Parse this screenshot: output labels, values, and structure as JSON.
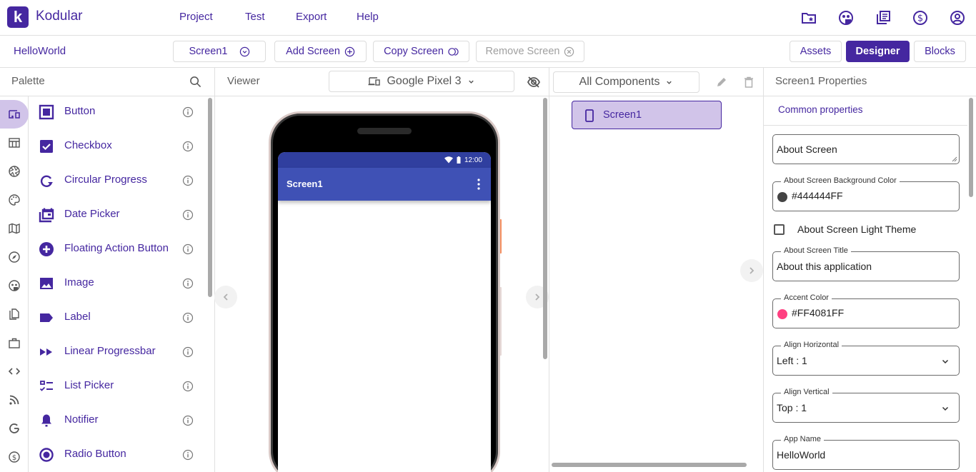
{
  "app": {
    "logo_letter": "k",
    "brand": "Kodular"
  },
  "topmenu": [
    {
      "label": "Project"
    },
    {
      "label": "Test"
    },
    {
      "label": "Export"
    },
    {
      "label": "Help"
    }
  ],
  "topicons": [
    "folder-star-icon",
    "community-icon",
    "library-icon",
    "dollar-icon",
    "account-icon"
  ],
  "toolbar": {
    "project_name": "HelloWorld",
    "screen_select": "Screen1",
    "add_screen": "Add Screen",
    "copy_screen": "Copy Screen",
    "remove_screen": "Remove Screen",
    "assets": "Assets",
    "designer": "Designer",
    "blocks": "Blocks"
  },
  "palette": {
    "title": "Palette",
    "categories": [
      "user-interface",
      "layout",
      "media",
      "drawing",
      "maps",
      "sensors",
      "social",
      "storage",
      "utilities",
      "connectivity",
      "dynamic",
      "google",
      "monetization"
    ],
    "items": [
      {
        "label": "Button",
        "icon": "button-icon"
      },
      {
        "label": "Checkbox",
        "icon": "checkbox-icon"
      },
      {
        "label": "Circular Progress",
        "icon": "circular-progress-icon"
      },
      {
        "label": "Date Picker",
        "icon": "date-picker-icon"
      },
      {
        "label": "Floating Action Button",
        "icon": "fab-icon"
      },
      {
        "label": "Image",
        "icon": "image-icon"
      },
      {
        "label": "Label",
        "icon": "label-icon"
      },
      {
        "label": "Linear Progressbar",
        "icon": "linear-progressbar-icon"
      },
      {
        "label": "List Picker",
        "icon": "list-picker-icon"
      },
      {
        "label": "Notifier",
        "icon": "notifier-icon"
      },
      {
        "label": "Radio Button",
        "icon": "radio-button-icon"
      }
    ]
  },
  "viewer": {
    "title": "Viewer",
    "device": "Google Pixel 3",
    "phone": {
      "time": "12:00",
      "screen_title": "Screen1"
    }
  },
  "components": {
    "filter": "All Components",
    "tree": [
      {
        "label": "Screen1",
        "selected": true
      }
    ]
  },
  "properties": {
    "title": "Screen1 Properties",
    "section": "Common properties",
    "about_screen": {
      "placeholder": "About Screen",
      "value": ""
    },
    "about_bg_color": {
      "label": "About Screen Background Color",
      "value": "#444444FF",
      "swatch": "#444444"
    },
    "about_light_theme": {
      "label": "About Screen Light Theme",
      "checked": false
    },
    "about_title": {
      "label": "About Screen Title",
      "value": "About this application"
    },
    "accent_color": {
      "label": "Accent Color",
      "value": "#FF4081FF",
      "swatch": "#FF4081"
    },
    "align_horizontal": {
      "label": "Align Horizontal",
      "value": "Left : 1"
    },
    "align_vertical": {
      "label": "Align Vertical",
      "value": "Top : 1"
    },
    "app_name": {
      "label": "App Name",
      "value": "HelloWorld"
    }
  },
  "colors": {
    "brand": "#4527A0",
    "selection": "#D1C4E9",
    "appbar": "#3F51B5",
    "statusbar": "#303F9F"
  }
}
